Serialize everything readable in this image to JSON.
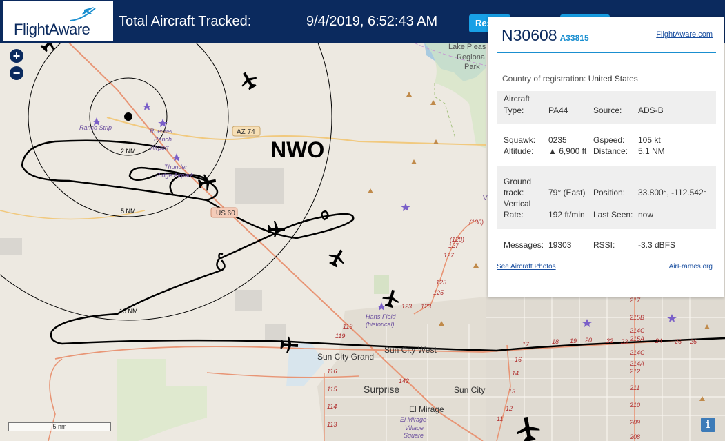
{
  "header": {
    "brand": "FlightAware",
    "title": "Total Aircraft Tracked:",
    "timestamp": "9/4/2019, 6:52:43 AM",
    "reset_label": "Res"
  },
  "map": {
    "airport_code": "NWO",
    "places": {
      "lake": "Lake Pleas",
      "regional": "Regiona",
      "park": "Park",
      "ranco": "Ranco Strip",
      "roesner": "Roesner",
      "ranch": "Ranch",
      "airport": "Airport",
      "thunder": "Thunder",
      "ridge": "Ridge Airpark",
      "harts": "Harts Field",
      "historical": "(historical)",
      "sun_city_grand": "Sun City Grand",
      "sun_city_west": "Sun City West",
      "surprise": "Surprise",
      "sun_city": "Sun City",
      "el_mirage": "El Mirage",
      "el_mirage_village_1": "El Mirage-",
      "el_mirage_village_2": "Village",
      "el_mirage_village_3": "Square",
      "v": "V"
    },
    "ring_labels": {
      "r2": "2 NM",
      "r5": "5 NM",
      "r10": "10 NM"
    },
    "roads": {
      "az74": "AZ 74",
      "us60": "US 60",
      "e130": "(130)",
      "e128": "(128)",
      "e127a": "127",
      "e127b": "127",
      "e125a": "125",
      "e125b": "125",
      "e123a": "123",
      "e123b": "123",
      "e119a": "119",
      "e119b": "119",
      "e116": "116",
      "e115": "115",
      "e114": "114",
      "e113": "113",
      "e142": "142",
      "e16": "16",
      "e14": "14",
      "e13": "13",
      "e12": "12",
      "e11": "11",
      "e17": "17",
      "e18": "18",
      "e19": "19",
      "e20": "20",
      "e22": "22",
      "e23": "23",
      "e24": "24",
      "e26a": "26",
      "e26b": "26",
      "e217": "217",
      "e215b": "215B",
      "e214c_a": "214C",
      "e215a": "215A",
      "e214c_b": "214C",
      "e214a": "214A",
      "e212": "212",
      "e211": "211",
      "e210": "210",
      "e209": "209",
      "e208": "208"
    },
    "zoom_in": "+",
    "zoom_out": "−",
    "scale_label": "5 nm",
    "info_label": "i"
  },
  "panel": {
    "registration": "N30608",
    "hex": "A33815",
    "fa_link": "FlightAware.com",
    "country_label": "Country of registration:",
    "country_value": "United States",
    "aircraft_label": "Aircraft",
    "type_label": "Type:",
    "type_value": "PA44",
    "source_label": "Source:",
    "source_value": "ADS-B",
    "squawk_label": "Squawk:",
    "squawk_value": "0235",
    "gspeed_label": "Gspeed:",
    "gspeed_value": "105 kt",
    "altitude_label": "Altitude:",
    "altitude_value": "▲ 6,900 ft",
    "distance_label": "Distance:",
    "distance_value": "5.1 NM",
    "ground_label": "Ground",
    "track_label": "track:",
    "track_value": "79° (East)",
    "position_label": "Position:",
    "position_value": "33.800°, -112.542°",
    "vertical_label": "Vertical",
    "rate_label": "Rate:",
    "rate_value": "192 ft/min",
    "lastseen_label": "Last Seen:",
    "lastseen_value": "now",
    "messages_label": "Messages:",
    "messages_value": "19303",
    "rssi_label": "RSSI:",
    "rssi_value": "-3.3 dBFS",
    "photos_link": "See Aircraft Photos",
    "airframes_link": "AirFrames.org"
  }
}
